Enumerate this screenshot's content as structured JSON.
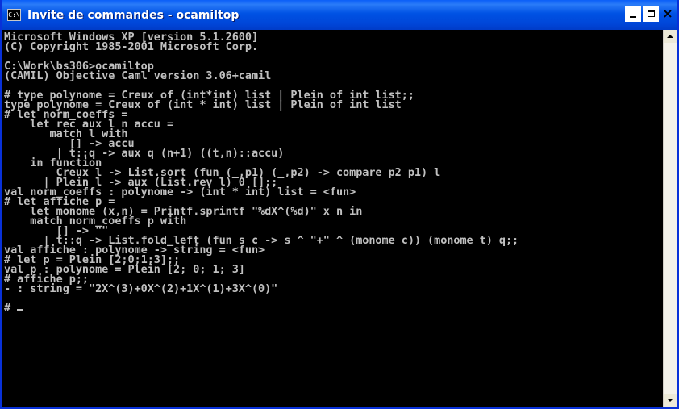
{
  "window": {
    "title": "Invite de commandes - ocamiltop",
    "icon_label": "C:\\",
    "colors": {
      "titlebar": "#0052e4",
      "console_bg": "#000000",
      "console_fg": "#c0c0c0"
    }
  },
  "console": {
    "lines": [
      "Microsoft Windows XP [version 5.1.2600]",
      "(C) Copyright 1985-2001 Microsoft Corp.",
      "",
      "C:\\Work\\bs306>ocamiltop",
      "(CAMIL) Objective Caml version 3.06+camil",
      "",
      "# type polynome = Creux of (int*int) list | Plein of int list;;",
      "type polynome = Creux of (int * int) list | Plein of int list",
      "# let norm_coeffs =",
      "    let rec aux l n accu =",
      "       match l with",
      "          [] -> accu",
      "        | t::q -> aux q (n+1) ((t,n)::accu)",
      "    in function",
      "        Creux l -> List.sort (fun (_,p1) (_,p2) -> compare p2 p1) l",
      "      | Plein l -> aux (List.rev l) 0 [];;",
      "val norm_coeffs : polynome -> (int * int) list = <fun>",
      "# let affiche p =",
      "    let monome (x,n) = Printf.sprintf \"%dX^(%d)\" x n in",
      "    match norm_coeffs p with",
      "        [] -> \"\"",
      "      | t::q -> List.fold_left (fun s c -> s ^ \"+\" ^ (monome c)) (monome t) q;;",
      "val affiche : polynome -> string = <fun>",
      "# let p = Plein [2;0;1;3];;",
      "val p : polynome = Plein [2; 0; 1; 3]",
      "# affiche p;;",
      "- : string = \"2X^(3)+0X^(2)+1X^(1)+3X^(0)\"",
      "",
      "# "
    ]
  },
  "buttons": {
    "minimize": "minimize",
    "maximize": "maximize",
    "close": "×"
  },
  "icons": {
    "window_icon": "cmd-icon",
    "scroll_up": "scroll-up-arrow-icon",
    "scroll_down": "scroll-down-arrow-icon"
  }
}
